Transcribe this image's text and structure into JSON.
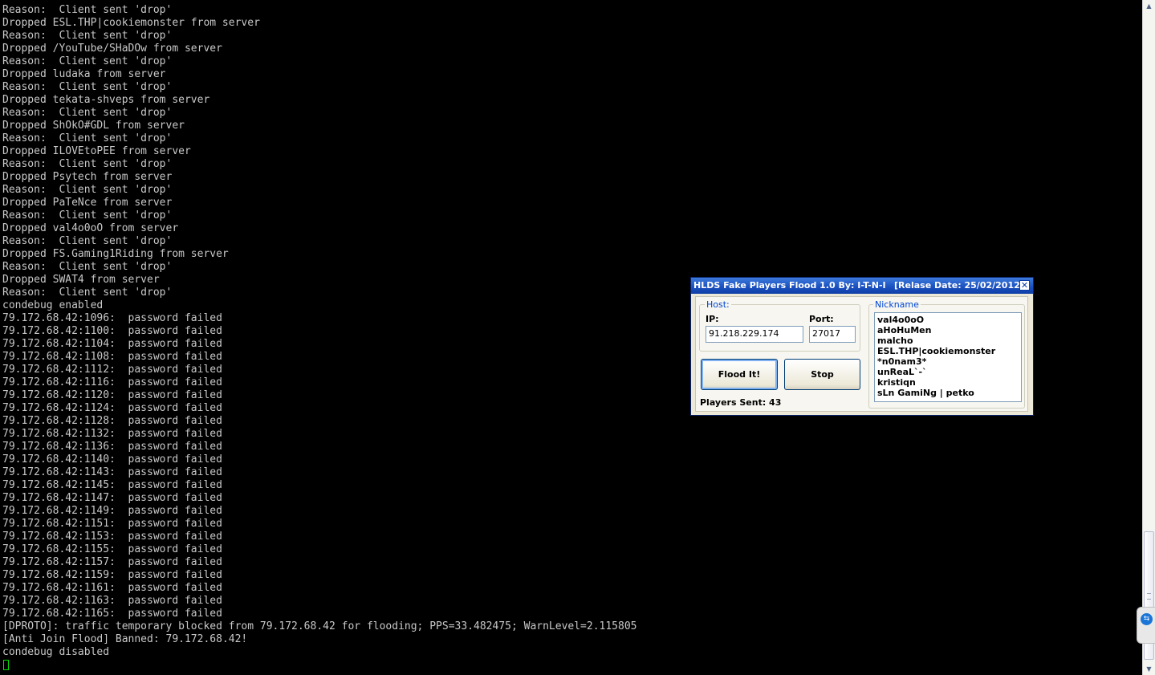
{
  "terminal": {
    "lines": [
      "Reason:  Client sent 'drop'",
      "Dropped ESL.THP|cookiemonster from server",
      "Reason:  Client sent 'drop'",
      "Dropped /YouTube/SHaDOw from server",
      "Reason:  Client sent 'drop'",
      "Dropped ludaka from server",
      "Reason:  Client sent 'drop'",
      "Dropped tekata-shveps from server",
      "Reason:  Client sent 'drop'",
      "Dropped ShOkO#GDL from server",
      "Reason:  Client sent 'drop'",
      "Dropped ILOVEtoPEE from server",
      "Reason:  Client sent 'drop'",
      "Dropped Psytech from server",
      "Reason:  Client sent 'drop'",
      "Dropped PaTeNce from server",
      "Reason:  Client sent 'drop'",
      "Dropped val4o0oO from server",
      "Reason:  Client sent 'drop'",
      "Dropped FS.Gaming1Riding from server",
      "Reason:  Client sent 'drop'",
      "Dropped SWAT4 from server",
      "Reason:  Client sent 'drop'",
      "condebug enabled",
      "79.172.68.42:1096:  password failed",
      "79.172.68.42:1100:  password failed",
      "79.172.68.42:1104:  password failed",
      "79.172.68.42:1108:  password failed",
      "79.172.68.42:1112:  password failed",
      "79.172.68.42:1116:  password failed",
      "79.172.68.42:1120:  password failed",
      "79.172.68.42:1124:  password failed",
      "79.172.68.42:1128:  password failed",
      "79.172.68.42:1132:  password failed",
      "79.172.68.42:1136:  password failed",
      "79.172.68.42:1140:  password failed",
      "79.172.68.42:1143:  password failed",
      "79.172.68.42:1145:  password failed",
      "79.172.68.42:1147:  password failed",
      "79.172.68.42:1149:  password failed",
      "79.172.68.42:1151:  password failed",
      "79.172.68.42:1153:  password failed",
      "79.172.68.42:1155:  password failed",
      "79.172.68.42:1157:  password failed",
      "79.172.68.42:1159:  password failed",
      "79.172.68.42:1161:  password failed",
      "79.172.68.42:1163:  password failed",
      "79.172.68.42:1165:  password failed",
      "[DPROTO]: traffic temporary blocked from 79.172.68.42 for flooding; PPS=33.482475; WarnLevel=2.115805",
      "[Anti Join Flood] Banned: 79.172.68.42!",
      "condebug disabled"
    ],
    "cursor_color": "#00e000"
  },
  "scrollbar": {
    "up_icon": "arrow-up-icon",
    "down_icon": "arrow-down-icon",
    "position_fraction": 0.98
  },
  "teamviewer_tab": {
    "icon": "teamviewer-icon",
    "glyph": "⇆"
  },
  "app": {
    "title": "HLDS Fake Players Flood 1.0 By: I-T-N-I",
    "release": "[Relase Date: 25/02/2012]",
    "close_glyph": "✕",
    "host_group_label": "Host:",
    "ip_label": "IP:",
    "ip_value": "91.218.229.174",
    "port_label": "Port:",
    "port_value": "27017",
    "flood_button_label": "Flood It!",
    "stop_button_label": "Stop",
    "players_sent_text": "Players Sent: 43",
    "nickname_group_label": "Nickname",
    "nicknames": [
      "val4o0oO",
      "aHoHuMen",
      "malcho",
      "ESL.THP|cookiemonster",
      "*n0nam3*",
      "unReaL`-`",
      "kristiqn",
      "sLn GamiNg | petko"
    ],
    "colors": {
      "title_bar": "#1a4fbf",
      "window_bg": "#ece9d8",
      "group_label": "#0046d5"
    }
  }
}
